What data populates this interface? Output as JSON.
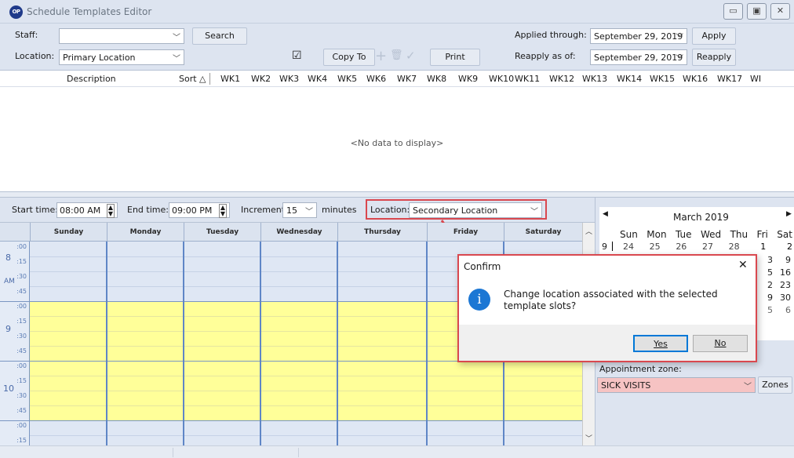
{
  "window": {
    "title": "Schedule Templates Editor",
    "logo": "OP"
  },
  "toolbar": {
    "staff_label": "Staff:",
    "staff_value": "",
    "search_label": "Search",
    "location_label": "Location:",
    "location_value": "Primary Location",
    "checkbox_glyph": "☑",
    "copy_to_label": "Copy To",
    "print_label": "Print",
    "applied_through_label": "Applied through:",
    "applied_through_value": "September 29, 2019",
    "apply_label": "Apply",
    "reapply_as_of_label": "Reapply as of:",
    "reapply_as_of_value": "September 29, 2019",
    "reapply_label": "Reapply"
  },
  "grid": {
    "headers": [
      "Description",
      "Sort △",
      "WK1",
      "WK2",
      "WK3",
      "WK4",
      "WK5",
      "WK6",
      "WK7",
      "WK8",
      "WK9",
      "WK10",
      "WK11",
      "WK12",
      "WK13",
      "WK14",
      "WK15",
      "WK16",
      "WK17",
      "WI"
    ],
    "empty_text": "<No data to display>"
  },
  "schedule": {
    "start_time_label": "Start time:",
    "start_time_value": "08:00 AM",
    "end_time_label": "End time:",
    "end_time_value": "09:00 PM",
    "increment_label": "Increment:",
    "increment_value": "15",
    "minutes_label": "minutes",
    "location_label": "Location:",
    "location_value": "Secondary Location",
    "days": [
      "Sunday",
      "Monday",
      "Tuesday",
      "Wednesday",
      "Thursday",
      "Friday",
      "Saturday"
    ],
    "hours": [
      {
        "hour": "8",
        "ampm": "AM"
      },
      {
        "hour": "9",
        "ampm": ""
      },
      {
        "hour": "10",
        "ampm": ""
      }
    ],
    "quarters": [
      ":00",
      ":15",
      ":30",
      ":45"
    ],
    "slot_colors": {
      "morning": "#dfe7f4",
      "available": "#ffff99"
    }
  },
  "calendar": {
    "month_label": "March 2019",
    "weekdays": [
      "Sun",
      "Mon",
      "Tue",
      "Wed",
      "Thu",
      "Fri",
      "Sat"
    ],
    "week_number": "9",
    "row1": [
      "24",
      "25",
      "26",
      "27",
      "28",
      "1",
      "2"
    ],
    "visible_right": [
      [
        "3",
        "9"
      ],
      [
        "5",
        "16"
      ],
      [
        "2",
        "23"
      ],
      [
        "9",
        "30"
      ],
      [
        "5",
        "6"
      ]
    ]
  },
  "zone": {
    "label": "Appointment zone:",
    "value": "SICK VISITS",
    "zones_button": "Zones",
    "zone_color": "#f6c3c3"
  },
  "dialog": {
    "title": "Confirm",
    "message": "Change location associated with the selected template slots?",
    "yes_label": "Yes",
    "no_label": "No",
    "info_icon_glyph": "i"
  }
}
